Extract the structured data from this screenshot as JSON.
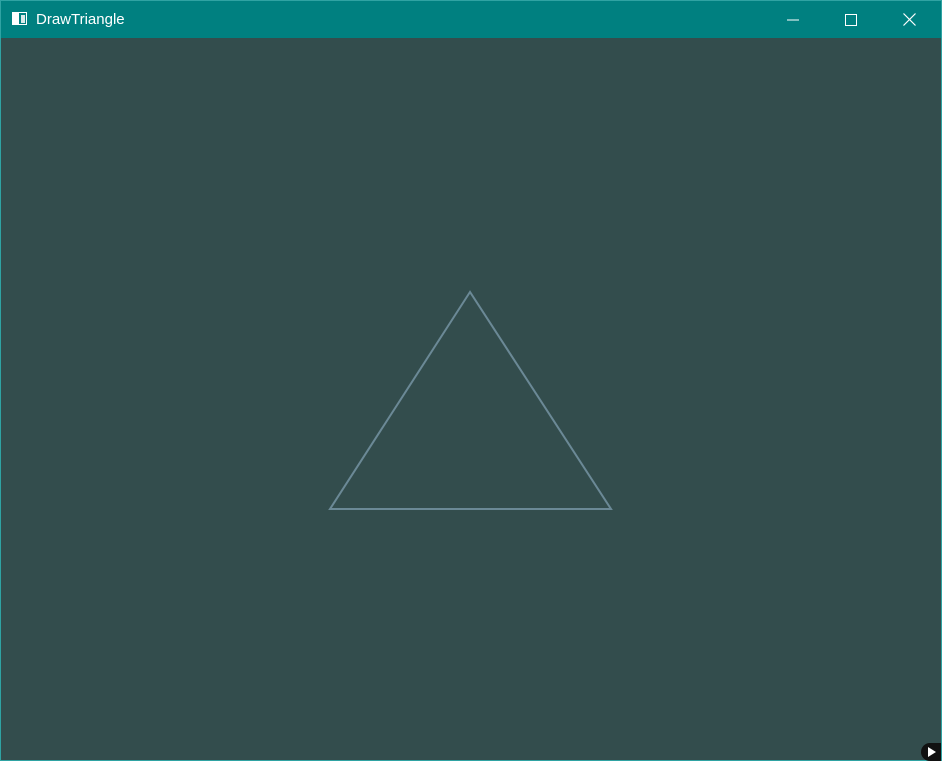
{
  "window": {
    "title": "DrawTriangle",
    "titlebar_color": "#008080",
    "background_color": "#334d4d"
  },
  "titlebar": {
    "app_icon": "window-app-icon",
    "buttons": [
      {
        "name": "minimize",
        "icon": "minimize-icon"
      },
      {
        "name": "maximize",
        "icon": "maximize-icon"
      },
      {
        "name": "close",
        "icon": "close-icon"
      }
    ]
  },
  "canvas": {
    "shape": "triangle",
    "outline_color": "#6b8996",
    "fill": "none"
  },
  "corner_badge": {
    "icon": "play-icon"
  }
}
